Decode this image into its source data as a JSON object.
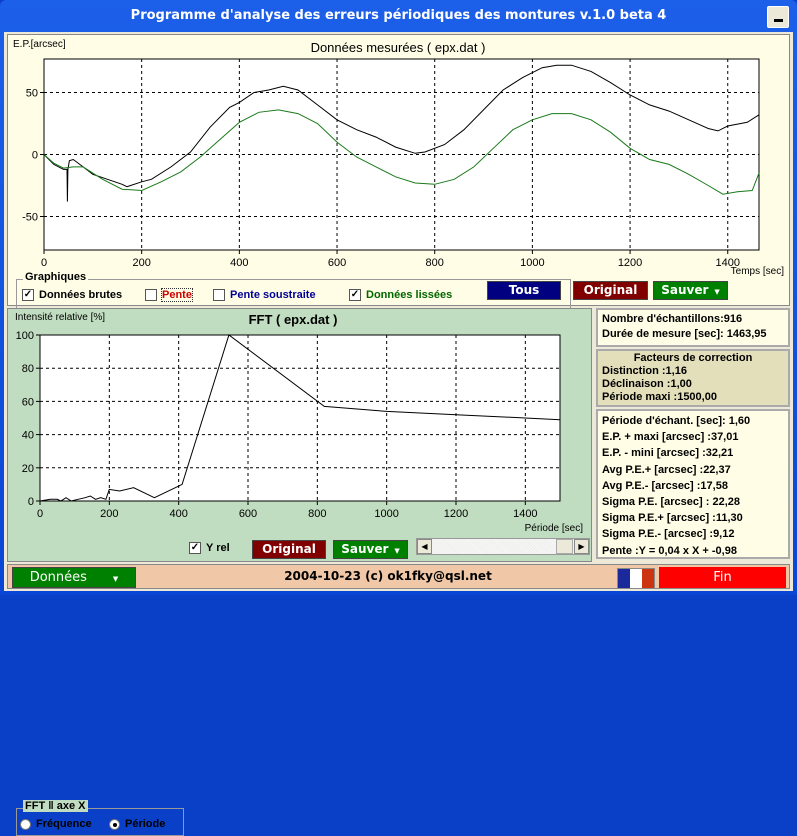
{
  "window": {
    "title": "Programme d'analyse des erreurs périodiques des montures v.1.0 beta 4",
    "minimize_label": "_"
  },
  "main_chart": {
    "y_axis_title": "E.P.[arcsec]",
    "x_axis_title": "Temps [sec]",
    "title": "Données mesurées ( epx.dat )"
  },
  "graphiques": {
    "group_label": "Graphiques",
    "checkboxes": [
      {
        "label": "Données brutes",
        "checked": true,
        "color": "#000000"
      },
      {
        "label": "Pente",
        "checked": false,
        "color": "#cc0000"
      },
      {
        "label": "Pente soustraite",
        "checked": false,
        "color": "#000099"
      },
      {
        "label": "Données lissées",
        "checked": true,
        "color": "#006600"
      }
    ],
    "buttons": {
      "tous": "Tous",
      "original": "Original",
      "sauver": "Sauver"
    }
  },
  "fft_chart": {
    "y_axis_title": "Intensité relative [%]",
    "x_axis_title": "Période [sec]",
    "title": "FFT ( epx.dat )"
  },
  "fft_controls": {
    "group_label": "FFT ‖ axe X",
    "radio_frequence": "Fréquence",
    "radio_periode": "Période",
    "selected": "Période",
    "yrel_label": "Y rel",
    "yrel_checked": true,
    "original_label": "Original",
    "sauver_label": "Sauver"
  },
  "info": {
    "samples": "Nombre d'échantillons:916",
    "duration": "Durée de mesure [sec]: 1463,95",
    "corr_header": "Facteurs de correction",
    "distinction": "Distinction :1,16",
    "declinaison": "Déclinaison :1,00",
    "periode_maxi": "Période maxi :1500,00",
    "stats": [
      "Période d'échant. [sec]: 1,60",
      "E.P. + maxi [arcsec] :37,01",
      "E.P. - mini [arcsec] :32,21",
      "Avg P.E.+ [arcsec] :22,37",
      "Avg P.E.- [arcsec] :17,58",
      "Sigma P.E. [arcsec] : 22,28",
      "Sigma P.E.+ [arcsec] :11,30",
      "Sigma P.E.- [arcsec] :9,12",
      "Pente :Y = 0,04 x X + -0,98"
    ]
  },
  "statusbar": {
    "donnees_label": "Données",
    "text": "2004-10-23 (c) ok1fky@qsl.net",
    "fin_label": "Fin"
  },
  "colors": {
    "btn_blue": "#000080",
    "btn_red": "#800000",
    "btn_green": "#008000",
    "btn_fin": "#ff0000",
    "raw_line": "#000000",
    "smooth_line": "#1a7a1a"
  },
  "chart_data": [
    {
      "type": "line",
      "title": "Données mesurées ( epx.dat )",
      "xlabel": "Temps [sec]",
      "ylabel": "E.P.[arcsec]",
      "xlim": [
        0,
        1464
      ],
      "ylim": [
        -77,
        77
      ],
      "xticks": [
        0,
        200,
        400,
        600,
        800,
        1000,
        1200,
        1400
      ],
      "yticks": [
        -50,
        0,
        50
      ],
      "grid": true,
      "series": [
        {
          "name": "Données brutes",
          "x": [
            0,
            20,
            40,
            47,
            48,
            49,
            52,
            60,
            80,
            100,
            130,
            160,
            170,
            200,
            220,
            260,
            300,
            340,
            380,
            400,
            430,
            460,
            490,
            520,
            560,
            600,
            640,
            680,
            720,
            760,
            780,
            820,
            860,
            900,
            940,
            980,
            1020,
            1050,
            1080,
            1120,
            1160,
            1200,
            1240,
            1280,
            1320,
            1360,
            1380,
            1400,
            1440,
            1464
          ],
          "y": [
            0,
            -8,
            -12,
            -12,
            -38,
            -12,
            -5,
            -4,
            -10,
            -16,
            -20,
            -24,
            -26,
            -22,
            -20,
            -10,
            2,
            22,
            38,
            42,
            50,
            52,
            55,
            52,
            40,
            28,
            20,
            14,
            6,
            1,
            2,
            8,
            20,
            36,
            52,
            62,
            70,
            72,
            72,
            67,
            58,
            48,
            40,
            35,
            28,
            21,
            19,
            23,
            26,
            32
          ]
        },
        {
          "name": "Données lissées",
          "x": [
            0,
            20,
            40,
            60,
            80,
            120,
            160,
            200,
            240,
            280,
            320,
            360,
            400,
            440,
            480,
            520,
            560,
            600,
            640,
            680,
            720,
            760,
            800,
            840,
            880,
            920,
            960,
            1000,
            1040,
            1080,
            1120,
            1160,
            1200,
            1240,
            1280,
            1320,
            1360,
            1390,
            1420,
            1450,
            1464
          ],
          "y": [
            0,
            -7,
            -11,
            -10,
            -10,
            -20,
            -28,
            -29,
            -22,
            -14,
            -2,
            12,
            26,
            34,
            36,
            33,
            25,
            10,
            -2,
            -10,
            -18,
            -23,
            -24,
            -20,
            -10,
            5,
            20,
            28,
            33,
            33,
            28,
            18,
            5,
            -4,
            -8,
            -16,
            -25,
            -32,
            -30,
            -29,
            -15
          ]
        }
      ]
    },
    {
      "type": "line",
      "title": "FFT ( epx.dat )",
      "xlabel": "Période [sec]",
      "ylabel": "Intensité relative [%]",
      "xlim": [
        0,
        1500
      ],
      "ylim": [
        0,
        100
      ],
      "xticks": [
        0,
        200,
        400,
        600,
        800,
        1000,
        1200,
        1400
      ],
      "yticks": [
        0,
        20,
        40,
        60,
        80,
        100
      ],
      "grid": true,
      "series": [
        {
          "name": "FFT",
          "x": [
            0,
            30,
            50,
            60,
            75,
            90,
            110,
            130,
            145,
            160,
            175,
            190,
            200,
            230,
            270,
            330,
            400,
            410,
            545,
            820,
            1000,
            1200,
            1400,
            1500
          ],
          "y": [
            0,
            1,
            1,
            0,
            2,
            0,
            1,
            2,
            3,
            1,
            2,
            1,
            7,
            6,
            8,
            2,
            9,
            10,
            100,
            57,
            54,
            52,
            50,
            49
          ]
        }
      ]
    }
  ]
}
